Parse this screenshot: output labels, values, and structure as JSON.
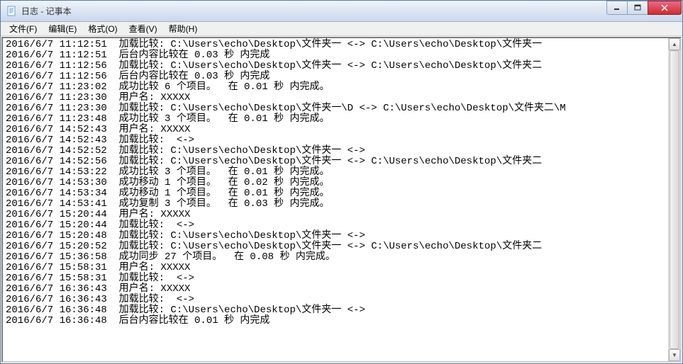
{
  "window": {
    "title": "日志 - 记事本"
  },
  "menu": {
    "file": "文件(F)",
    "edit": "编辑(E)",
    "format": "格式(O)",
    "view": "查看(V)",
    "help": "帮助(H)"
  },
  "log_lines": [
    "2016/6/7 11:12:51  加载比较: C:\\Users\\echo\\Desktop\\文件夹一 <-> C:\\Users\\echo\\Desktop\\文件夹一",
    "2016/6/7 11:12:51  后台内容比较在 0.03 秒 内完成",
    "2016/6/7 11:12:56  加载比较: C:\\Users\\echo\\Desktop\\文件夹一 <-> C:\\Users\\echo\\Desktop\\文件夹二",
    "2016/6/7 11:12:56  后台内容比较在 0.03 秒 内完成",
    "2016/6/7 11:23:02  成功比较 6 个项目。  在 0.01 秒 内完成。",
    "2016/6/7 11:23:30  用户名: XXXXX",
    "2016/6/7 11:23:30  加载比较: C:\\Users\\echo\\Desktop\\文件夹一\\D <-> C:\\Users\\echo\\Desktop\\文件夹二\\M",
    "2016/6/7 11:23:48  成功比较 3 个项目。  在 0.01 秒 内完成。",
    "2016/6/7 14:52:43  用户名: XXXXX",
    "2016/6/7 14:52:43  加载比较:  <-> ",
    "2016/6/7 14:52:52  加载比较: C:\\Users\\echo\\Desktop\\文件夹一 <-> ",
    "2016/6/7 14:52:56  加载比较: C:\\Users\\echo\\Desktop\\文件夹一 <-> C:\\Users\\echo\\Desktop\\文件夹二",
    "2016/6/7 14:53:22  成功比较 3 个项目。  在 0.01 秒 内完成。",
    "2016/6/7 14:53:30  成功移动 1 个项目。  在 0.02 秒 内完成。",
    "2016/6/7 14:53:34  成功移动 1 个项目。  在 0.01 秒 内完成。",
    "2016/6/7 14:53:41  成功复制 3 个项目。  在 0.03 秒 内完成。",
    "2016/6/7 15:20:44  用户名: XXXXX",
    "2016/6/7 15:20:44  加载比较:  <-> ",
    "2016/6/7 15:20:48  加载比较: C:\\Users\\echo\\Desktop\\文件夹一 <-> ",
    "2016/6/7 15:20:52  加载比较: C:\\Users\\echo\\Desktop\\文件夹一 <-> C:\\Users\\echo\\Desktop\\文件夹二",
    "2016/6/7 15:36:58  成功同步 27 个项目。  在 0.08 秒 内完成。",
    "2016/6/7 15:58:31  用户名: XXXXX",
    "2016/6/7 15:58:31  加载比较:  <-> ",
    "2016/6/7 16:36:43  用户名: XXXXX",
    "2016/6/7 16:36:43  加载比较:  <-> ",
    "2016/6/7 16:36:48  加载比较: C:\\Users\\echo\\Desktop\\文件夹一 <-> ",
    "2016/6/7 16:36:48  后台内容比较在 0.01 秒 内完成"
  ]
}
